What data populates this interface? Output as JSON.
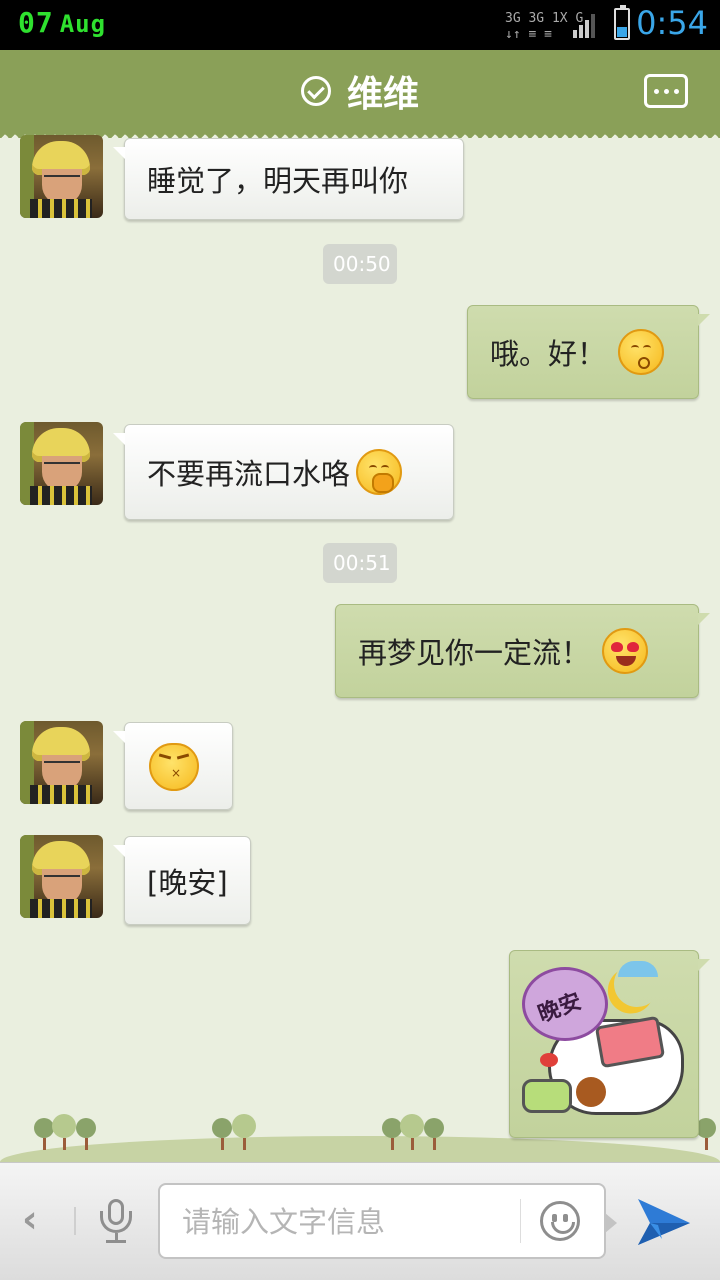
{
  "status": {
    "date_day": "07",
    "date_month": "Aug",
    "signal_text_1": "3G 3G 1X G",
    "time": "0:54",
    "battery_level": 0.35
  },
  "header": {
    "title": "维维",
    "verified_icon": "check-circle-icon",
    "menu_icon": "chat-menu-icon"
  },
  "messages": [
    {
      "side": "left",
      "text": "睡觉了，明天再叫你"
    },
    {
      "type": "time",
      "text": "00:50"
    },
    {
      "side": "right",
      "text": "哦。好！",
      "emoji": "kiss-face-icon"
    },
    {
      "side": "left",
      "text": "不要再流口水咯",
      "emoji": "drool-face-icon"
    },
    {
      "type": "time",
      "text": "00:51"
    },
    {
      "side": "right",
      "text": "再梦见你一定流！",
      "emoji": "heart-eyes-icon"
    },
    {
      "side": "left",
      "text": "",
      "emoji": "angry-face-icon"
    },
    {
      "side": "left",
      "text": "[晚安]"
    },
    {
      "side": "right",
      "sticker": "goodnight-sticker",
      "sticker_text": "晚安"
    }
  ],
  "input_bar": {
    "placeholder": "请输入文字信息",
    "value": "",
    "back_icon": "chevron-left-icon",
    "mic_icon": "microphone-icon",
    "emoji_icon": "smiley-icon",
    "send_icon": "send-icon"
  }
}
